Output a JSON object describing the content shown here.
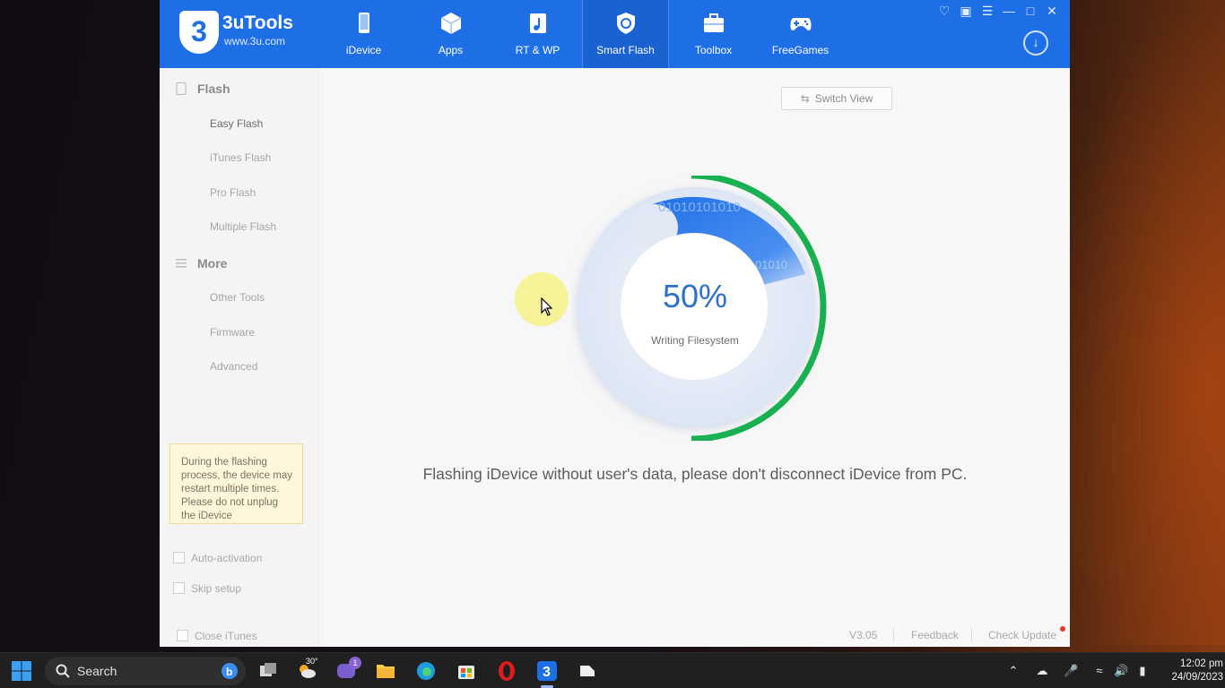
{
  "app": {
    "name": "3uTools",
    "url": "www.3u.com",
    "logo_digit": "3"
  },
  "nav": {
    "items": [
      {
        "label": "iDevice",
        "icon": "phone-icon"
      },
      {
        "label": "Apps",
        "icon": "box-icon"
      },
      {
        "label": "RT & WP",
        "icon": "music-file-icon"
      },
      {
        "label": "Smart Flash",
        "icon": "refresh-shield-icon",
        "active": true
      },
      {
        "label": "Toolbox",
        "icon": "briefcase-icon"
      },
      {
        "label": "FreeGames",
        "icon": "gamepad-icon"
      }
    ]
  },
  "window_controls": [
    "shirt-icon",
    "clipboard-icon",
    "menu-icon",
    "minimize-icon",
    "maximize-icon",
    "close-icon"
  ],
  "sidebar": {
    "sections": [
      {
        "title": "Flash",
        "items": [
          "Easy Flash",
          "iTunes Flash",
          "Pro Flash",
          "Multiple Flash"
        ],
        "active_item": "Easy Flash"
      },
      {
        "title": "More",
        "items": [
          "Other Tools",
          "Firmware",
          "Advanced"
        ]
      }
    ],
    "tip": "During the flashing process, the device may restart multiple times. Please do not unplug the iDevice",
    "options": [
      {
        "label": "Auto-activation",
        "checked": false
      },
      {
        "label": "Skip setup",
        "checked": false
      }
    ]
  },
  "main": {
    "switch_view_label": "Switch View",
    "progress_percent": 50,
    "progress_label": "50%",
    "progress_status": "Writing Filesystem",
    "binary_text_1": "01010101010",
    "binary_text_2": "01010",
    "message": "Flashing iDevice without user's data, please don't disconnect iDevice from PC."
  },
  "statusbar": {
    "close_itunes": "Close iTunes",
    "version": "V3.05",
    "feedback": "Feedback",
    "check_update": "Check Update"
  },
  "taskbar": {
    "search_placeholder": "Search",
    "weather_temp": "30°",
    "chat_badge": "1",
    "time": "12:02 pm",
    "date": "24/09/2023"
  },
  "colors": {
    "brand_blue": "#1e6fe6",
    "progress_green": "#19b051",
    "progress_text": "#2c71c9",
    "tip_bg": "#fdf6da"
  }
}
